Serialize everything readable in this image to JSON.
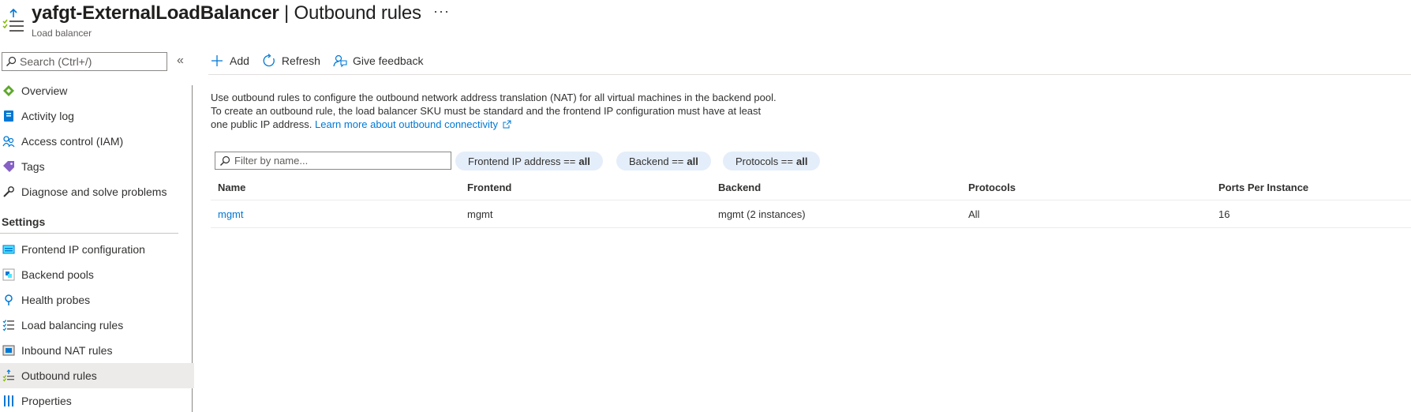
{
  "header": {
    "resource_name": "yafgt-ExternalLoadBalancer",
    "separator": " | ",
    "page_name": "Outbound rules",
    "subtitle": "Load balancer",
    "more_label": "···"
  },
  "sidebar": {
    "search_placeholder": "Search (Ctrl+/)",
    "collapse_label": "«",
    "items": [
      {
        "label": "Overview",
        "icon": "overview-icon"
      },
      {
        "label": "Activity log",
        "icon": "activity-log-icon"
      },
      {
        "label": "Access control (IAM)",
        "icon": "iam-icon"
      },
      {
        "label": "Tags",
        "icon": "tag-icon"
      },
      {
        "label": "Diagnose and solve problems",
        "icon": "wrench-icon"
      }
    ],
    "section_settings": "Settings",
    "settings_items": [
      {
        "label": "Frontend IP configuration",
        "icon": "frontend-ip-icon"
      },
      {
        "label": "Backend pools",
        "icon": "backend-pool-icon"
      },
      {
        "label": "Health probes",
        "icon": "health-probe-icon"
      },
      {
        "label": "Load balancing rules",
        "icon": "lb-rules-icon"
      },
      {
        "label": "Inbound NAT rules",
        "icon": "inbound-nat-icon"
      },
      {
        "label": "Outbound rules",
        "icon": "outbound-rules-icon",
        "selected": true
      },
      {
        "label": "Properties",
        "icon": "properties-icon"
      }
    ]
  },
  "toolbar": {
    "add_label": "Add",
    "refresh_label": "Refresh",
    "feedback_label": "Give feedback"
  },
  "description": {
    "text": "Use outbound rules to configure the outbound network address translation (NAT) for all virtual machines in the backend pool. To create an outbound rule, the load balancer SKU must be standard and the frontend IP configuration must have at least one public IP address.",
    "link": "Learn more about outbound connectivity"
  },
  "filters": {
    "name_placeholder": "Filter by name...",
    "frontend_label": "Frontend IP address ==",
    "frontend_value": "all",
    "backend_label": "Backend ==",
    "backend_value": "all",
    "protocols_label": "Protocols ==",
    "protocols_value": "all"
  },
  "table": {
    "columns": [
      "Name",
      "Frontend",
      "Backend",
      "Protocols",
      "Ports Per Instance"
    ],
    "rows": [
      [
        "mgmt",
        "mgmt",
        "mgmt (2 instances)",
        "All",
        "16"
      ]
    ]
  },
  "colors": {
    "accent": "#0078d4",
    "pill_bg": "#e4eefa",
    "selected_bg": "#edebe9"
  }
}
